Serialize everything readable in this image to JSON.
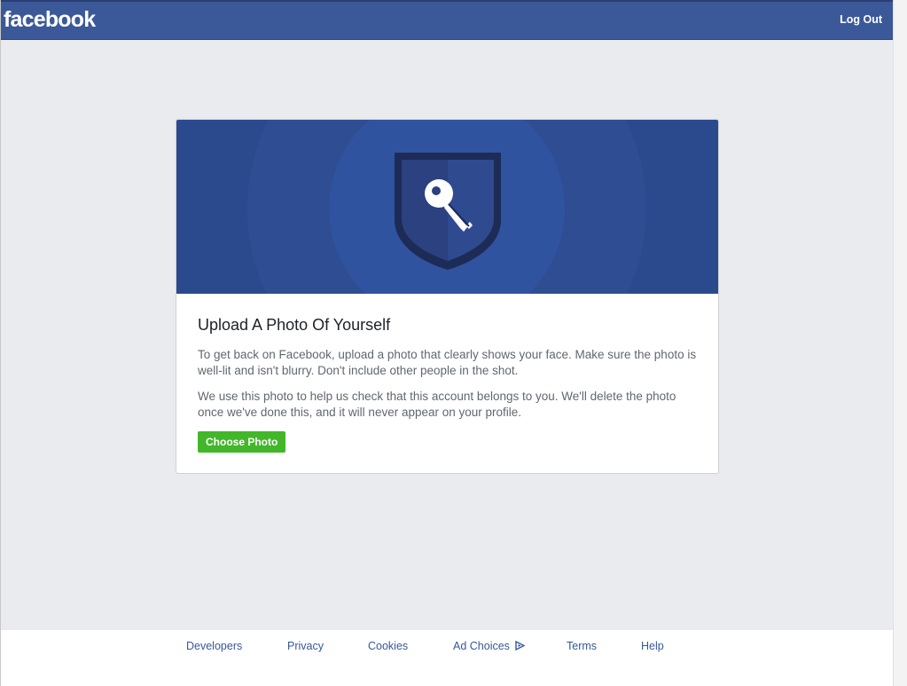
{
  "header": {
    "logo_text": "facebook",
    "logout_label": "Log Out",
    "bar_color": "#3b5998"
  },
  "card": {
    "banner_icon": "shield-key-icon",
    "title": "Upload A Photo Of Yourself",
    "paragraph_1": "To get back on Facebook, upload a photo that clearly shows your face. Make sure the photo is well-lit and isn't blurry. Don't include other people in the shot.",
    "paragraph_2": "We use this photo to help us check that this account belongs to you. We'll delete the photo once we've done this, and it will never appear on your profile.",
    "button_label": "Choose Photo",
    "button_color": "#42b72a"
  },
  "footer": {
    "links": [
      {
        "label": "Developers"
      },
      {
        "label": "Privacy"
      },
      {
        "label": "Cookies"
      },
      {
        "label": "Ad Choices",
        "icon": "ad-choices-icon"
      },
      {
        "label": "Terms"
      },
      {
        "label": "Help"
      }
    ]
  }
}
